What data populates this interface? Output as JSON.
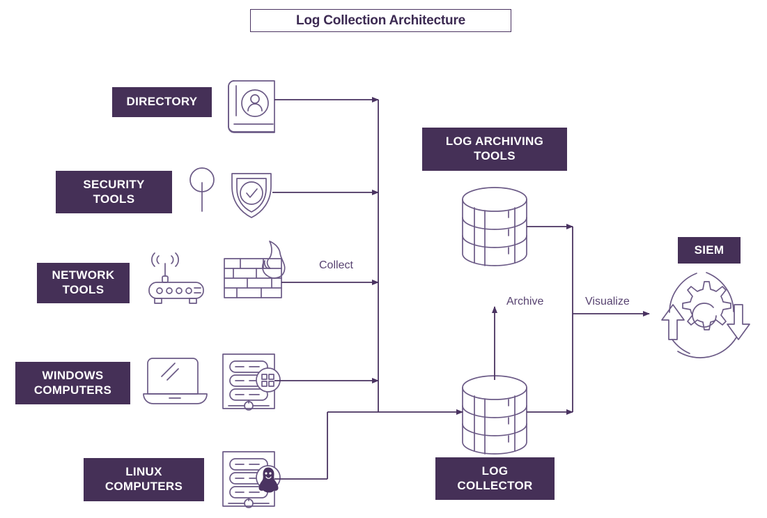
{
  "diagram": {
    "title": "Log Collection Architecture",
    "background_color": "#ffffff",
    "accent_color": "#453057",
    "line_color": "#4a3361",
    "icon_stroke_color": "#7a6b91",
    "label_text_color": "#574270"
  },
  "sources": [
    {
      "id": "directory",
      "label_lines": [
        "DIRECTORY"
      ],
      "icon": "address-book-icon"
    },
    {
      "id": "security-tools",
      "label_lines": [
        "SECURITY",
        "TOOLS"
      ],
      "icon": "shield-check-icon",
      "secondary_icon": "magnifier-pin-icon"
    },
    {
      "id": "network-tools",
      "label_lines": [
        "NETWORK",
        "TOOLS"
      ],
      "icon": "firewall-brick-flame-icon",
      "secondary_icon": "wireless-router-icon"
    },
    {
      "id": "windows-computers",
      "label_lines": [
        "WINDOWS",
        "COMPUTERS"
      ],
      "icon": "server-windows-icon",
      "secondary_icon": "laptop-icon"
    },
    {
      "id": "linux-computers",
      "label_lines": [
        "LINUX",
        "COMPUTERS"
      ],
      "icon": "server-linux-icon"
    }
  ],
  "nodes": [
    {
      "id": "log-archiving-tools",
      "label_lines": [
        "LOG ARCHIVING",
        "TOOLS"
      ],
      "icon": "database-stack-icon"
    },
    {
      "id": "log-collector",
      "label_lines": [
        "LOG",
        "COLLECTOR"
      ],
      "icon": "database-stack-icon"
    },
    {
      "id": "siem",
      "label_lines": [
        "SIEM"
      ],
      "icon": "gear-refresh-icon"
    }
  ],
  "edges": [
    {
      "id": "collect",
      "label": "Collect",
      "from": "sources",
      "to": "log-collector"
    },
    {
      "id": "archive",
      "label": "Archive",
      "from": "log-collector",
      "to": "log-archiving-tools"
    },
    {
      "id": "visualize",
      "label": "Visualize",
      "from": "log-collector",
      "to": "siem"
    }
  ]
}
